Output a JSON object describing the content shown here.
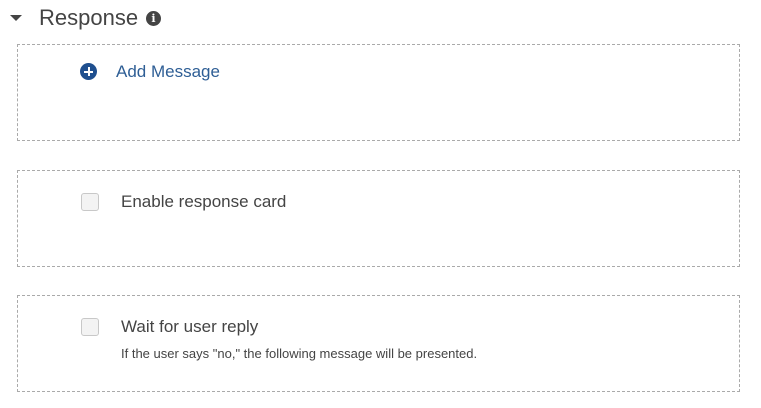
{
  "section": {
    "title": "Response",
    "info_icon": "info-icon",
    "caret_icon": "caret-down-icon"
  },
  "add_message": {
    "icon": "plus-circle-icon",
    "label": "Add Message",
    "color": "#2e5e95"
  },
  "response_card": {
    "label": "Enable response card",
    "checked": false
  },
  "wait_reply": {
    "label": "Wait for user reply",
    "helper": "If the user says \"no,\" the following message will be presented.",
    "checked": false
  }
}
